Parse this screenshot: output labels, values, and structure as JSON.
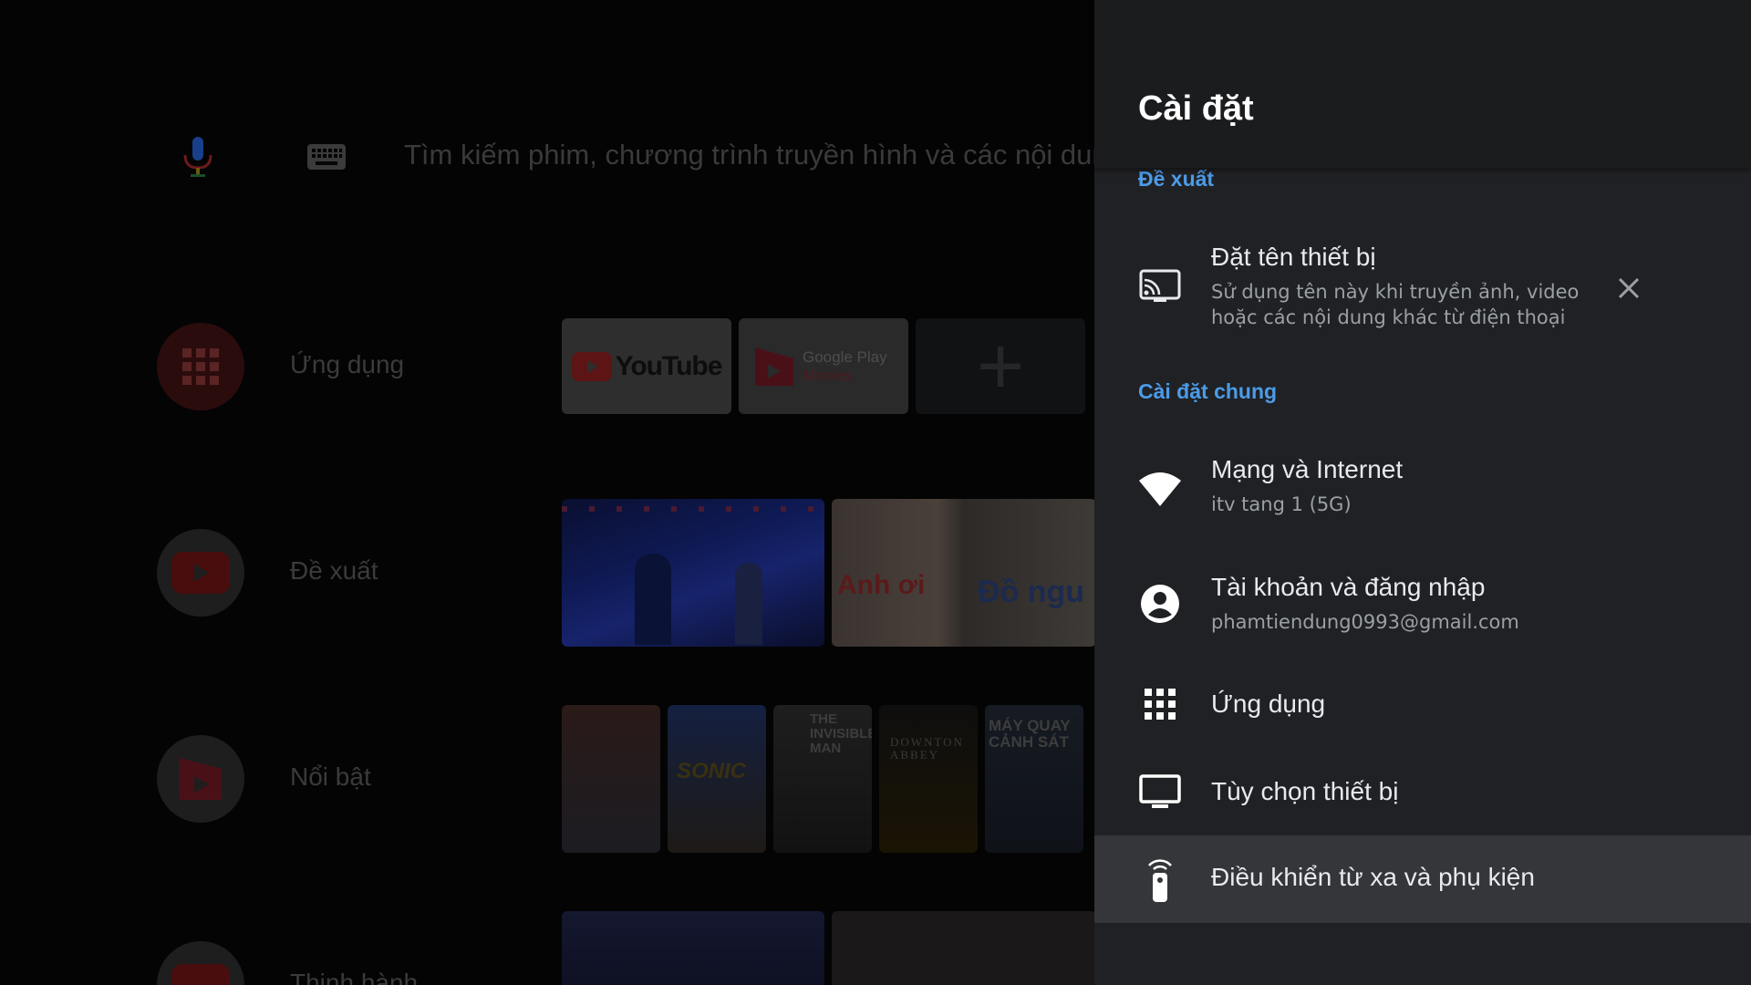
{
  "launcher": {
    "search_placeholder": "Tìm kiếm phim, chương trình truyền hình và các nội dung khác",
    "rows": [
      {
        "label": "Ứng dụng",
        "icon": "apps-grid-icon"
      },
      {
        "label": "Đề xuất",
        "icon": "youtube-icon"
      },
      {
        "label": "Nổi bật",
        "icon": "play-movies-icon"
      },
      {
        "label": "Thịnh hành",
        "icon": "youtube-icon"
      }
    ],
    "apps": {
      "youtube": "YouTube",
      "google_play_line1": "Google Play",
      "google_play_line2": "Movies",
      "add_symbol": "+"
    },
    "thumbnail_texts": {
      "left": "Anh ơi",
      "right": "Đồ ngu"
    },
    "posters": [
      {
        "text": ""
      },
      {
        "text": "SONIC"
      },
      {
        "text": "THE INVISIBLE MAN"
      },
      {
        "text": "DOWNTON ABBEY"
      },
      {
        "text": "MÁY QUAY CẢNH SÁT"
      }
    ]
  },
  "settings": {
    "title": "Cài đặt",
    "sections": {
      "suggested": "Đề xuất",
      "general": "Cài đặt chung"
    },
    "items": {
      "device_name": {
        "title": "Đặt tên thiết bị",
        "subtitle": "Sử dụng tên này khi truyền ảnh, video hoặc các nội dung khác từ điện thoại",
        "icon": "cast-icon"
      },
      "network": {
        "title": "Mạng và Internet",
        "subtitle": "itv tang 1 (5G)",
        "icon": "wifi-icon"
      },
      "account": {
        "title": "Tài khoản và đăng nhập",
        "subtitle": "phamtiendung0993@gmail.com",
        "icon": "account-circle-icon"
      },
      "apps": {
        "title": "Ứng dụng",
        "icon": "apps-grid-icon"
      },
      "device_prefs": {
        "title": "Tùy chọn thiết bị",
        "icon": "tv-icon"
      },
      "remotes": {
        "title": "Điều khiển từ xa và phụ kiện",
        "icon": "remote-icon"
      }
    },
    "colors": {
      "panel_bg": "#202124",
      "accent": "#4c9be8",
      "focused_bg": "#35363a"
    }
  }
}
